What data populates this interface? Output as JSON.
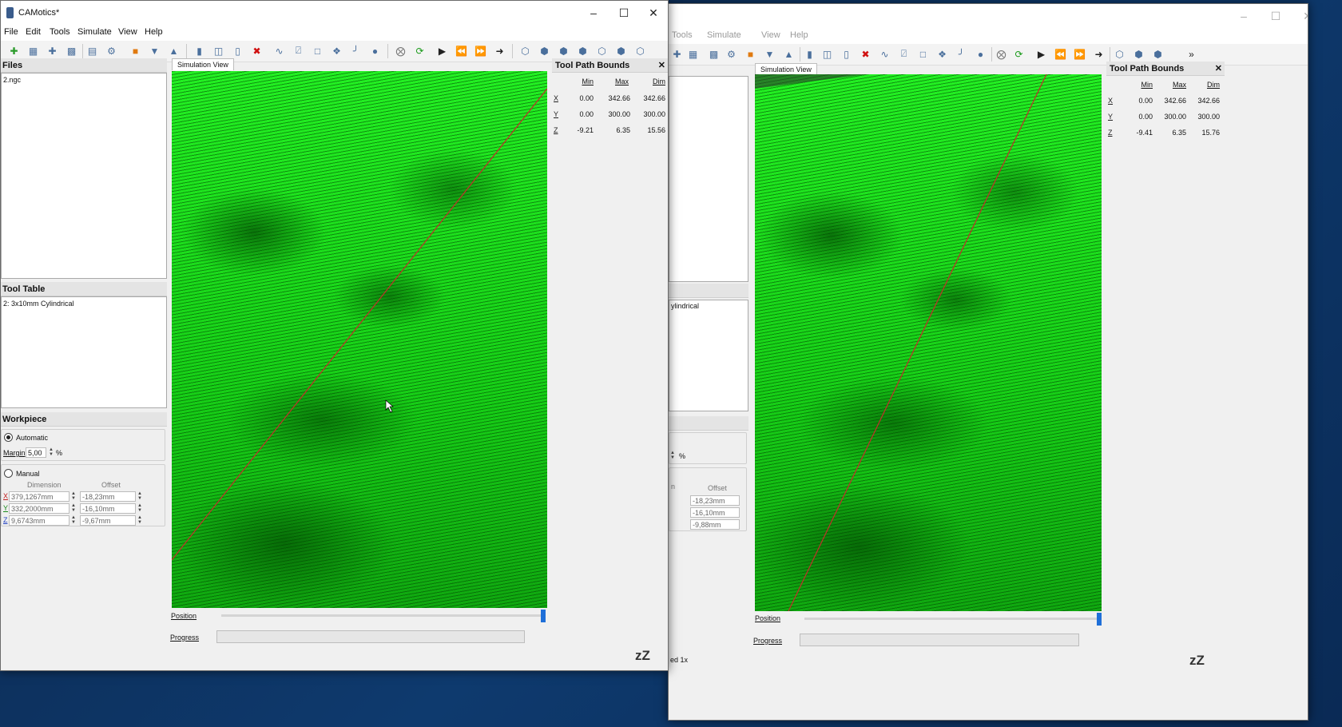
{
  "window1": {
    "title": "CAMotics*",
    "menu": [
      "File",
      "Edit",
      "Tools",
      "Simulate",
      "View",
      "Help"
    ],
    "files_panel": {
      "title": "Files",
      "items": [
        "2.ngc"
      ]
    },
    "tool_table_panel": {
      "title": "Tool Table",
      "items": [
        "2: 3x10mm Cylindrical"
      ]
    },
    "workpiece_panel": {
      "title": "Workpiece",
      "automatic_label": "Automatic",
      "margin_label": "Margin",
      "margin_value": "5,00",
      "margin_unit": "%",
      "manual_label": "Manual",
      "dimension_header": "Dimension",
      "offset_header": "Offset",
      "rows": [
        {
          "axis": "X",
          "dimension": "379,1267mm",
          "offset": "-18,23mm"
        },
        {
          "axis": "Y",
          "dimension": "332,2000mm",
          "offset": "-16,10mm"
        },
        {
          "axis": "Z",
          "dimension": "9,6743mm",
          "offset": "-9,67mm"
        }
      ],
      "selected_mode": "automatic"
    },
    "view_tab": "Simulation View",
    "bounds": {
      "title": "Tool Path Bounds",
      "headers": [
        "Min",
        "Max",
        "Dim"
      ],
      "rows": [
        {
          "axis": "X",
          "min": "0.00",
          "max": "342.66",
          "dim": "342.66"
        },
        {
          "axis": "Y",
          "min": "0.00",
          "max": "300.00",
          "dim": "300.00"
        },
        {
          "axis": "Z",
          "min": "-9.21",
          "max": "6.35",
          "dim": "15.56"
        }
      ]
    },
    "position_label": "Position",
    "progress_label": "Progress",
    "position_value": 1.0,
    "sleep_glyph": "zZ"
  },
  "window2": {
    "menu": [
      "Tools",
      "Simulate",
      "View",
      "Help"
    ],
    "tool_item_partial": "ylindrical",
    "margin_unit": "%",
    "dimension_header_partial": "n",
    "offset_header": "Offset",
    "rows": [
      {
        "dimension_partial": "n",
        "offset": "-18,23mm"
      },
      {
        "dimension_partial": "n",
        "offset": "-16,10mm"
      },
      {
        "dimension_partial": "",
        "offset": "-9,88mm"
      }
    ],
    "view_tab": "Simulation View",
    "bounds": {
      "title": "Tool Path Bounds",
      "headers": [
        "Min",
        "Max",
        "Dim"
      ],
      "rows": [
        {
          "axis": "X",
          "min": "0.00",
          "max": "342.66",
          "dim": "342.66"
        },
        {
          "axis": "Y",
          "min": "0.00",
          "max": "300.00",
          "dim": "300.00"
        },
        {
          "axis": "Z",
          "min": "-9.41",
          "max": "6.35",
          "dim": "15.76"
        }
      ]
    },
    "position_label": "Position",
    "progress_label": "Progress",
    "position_value": 1.0,
    "status_partial": "ed 1x",
    "sleep_glyph": "zZ",
    "overflow_glyph": "»"
  },
  "colors": {
    "simulation_green": "#18d818",
    "toolpath_red": "#c0302a",
    "slider_blue": "#1f6fd8"
  }
}
